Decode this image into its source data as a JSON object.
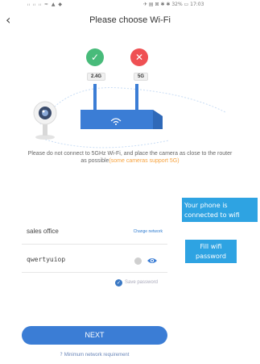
{
  "status_bar": {
    "left": "ᵢₗ ᵢₗ ᵢₗ ≈ ▲ ◆",
    "right": "✈ ▤ ⊠ ✱ ✱ 32% ▭ 17:03"
  },
  "header": {
    "back_glyph": "‹",
    "title": "Please choose Wi-Fi"
  },
  "bands": {
    "supported": "2.4G",
    "unsupported": "5G"
  },
  "description": {
    "main": "Please do not connect to 5GHz Wi-Fi, and place the camera as close to the router as possible",
    "highlight": "(some cameras support 5G)"
  },
  "tooltips": {
    "connected": "Your phone is connected to wifi",
    "fill_password": "Fill wifi password"
  },
  "ssid_field": {
    "value": "sales office",
    "change_link": "Change network"
  },
  "password_field": {
    "value": "qwertyuiop"
  },
  "save_password": {
    "label": "Save password"
  },
  "next_button": {
    "label": "NEXT"
  },
  "min_requirement": {
    "icon": "?",
    "label": "Minimum network requirement"
  },
  "colors": {
    "accent": "#3b7dd5",
    "success": "#48bb7a",
    "error": "#ef5053",
    "highlight": "#f7a23d",
    "tooltip": "#2ea3e2"
  }
}
